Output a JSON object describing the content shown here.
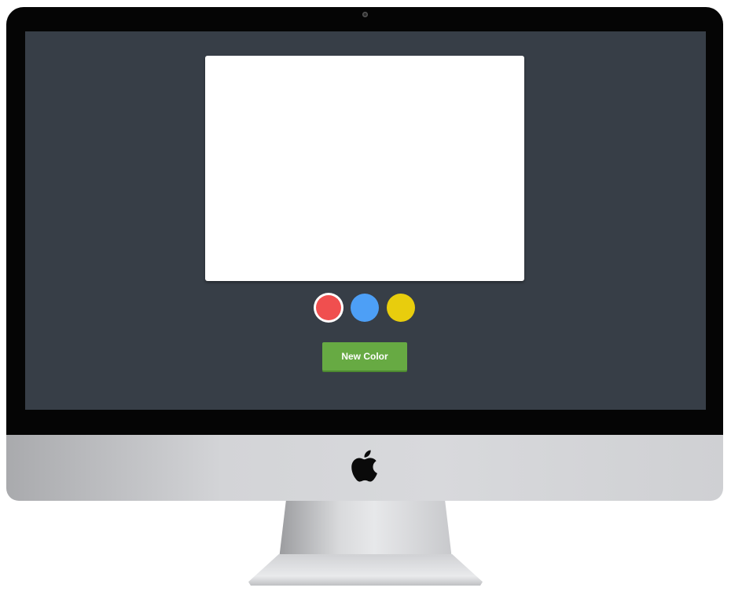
{
  "toolbar": {
    "new_color_label": "New Color"
  },
  "palette": {
    "swatches": [
      {
        "name": "red",
        "color": "#f04f4f",
        "selected": true
      },
      {
        "name": "blue",
        "color": "#4d9ff6",
        "selected": false
      },
      {
        "name": "yellow",
        "color": "#e8cd0d",
        "selected": false
      }
    ]
  },
  "canvas": {
    "background": "#ffffff"
  },
  "screen": {
    "background": "#373e47"
  },
  "icons": {
    "logo": "apple-logo-icon"
  }
}
